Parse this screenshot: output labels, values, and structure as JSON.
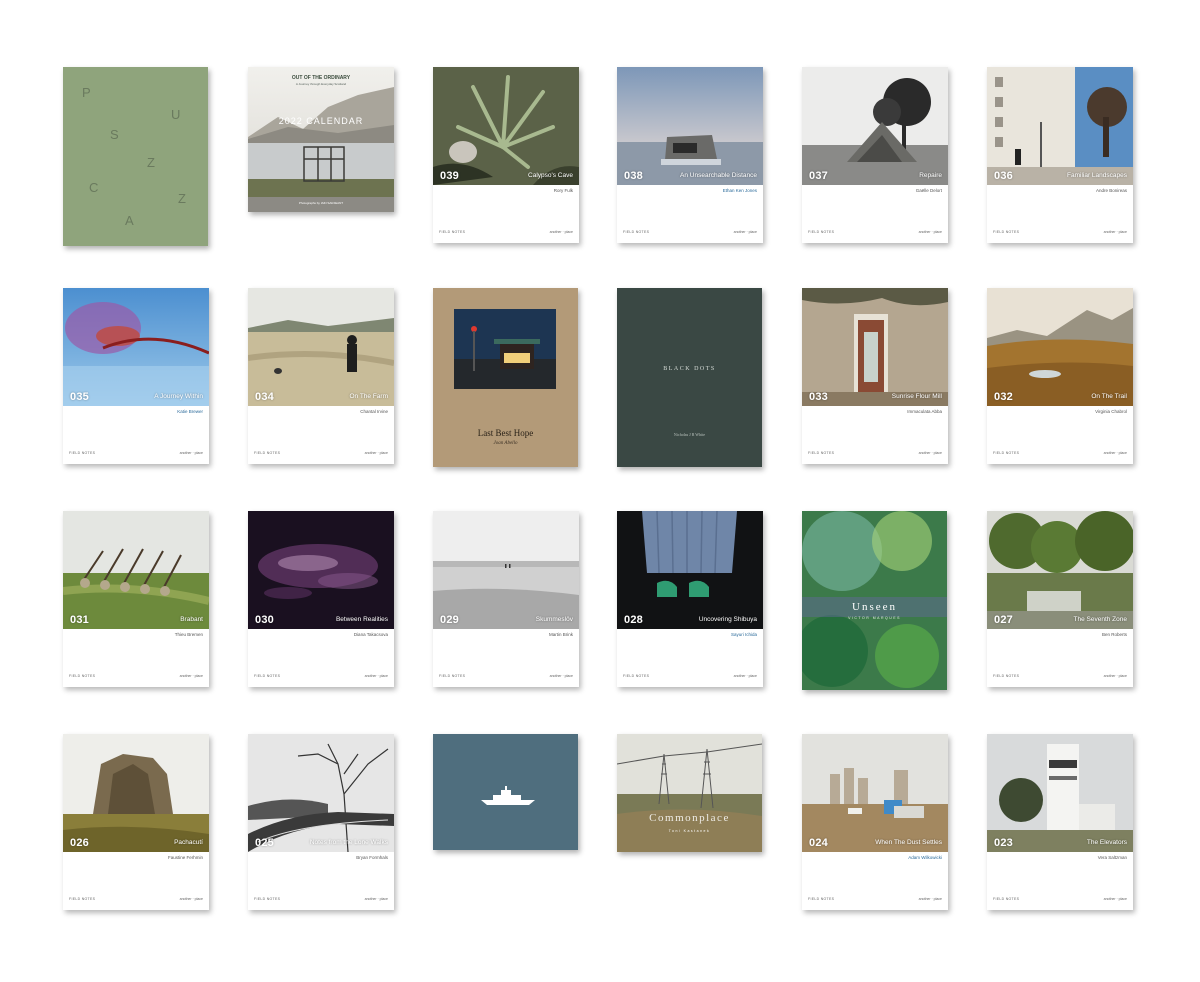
{
  "colors": {
    "background": "#ffffff",
    "fieldnotes_card": "#ffffff",
    "puszcza_cover": "#8fa47c",
    "last_best_hope_cover": "#b39a78",
    "black_dots_cover": "#3a4844",
    "ship_cover": "#4f6e7e"
  },
  "field_notes": {
    "series_label": "FIELD NOTES",
    "publisher_label": "another · place",
    "issues": [
      {
        "number": "039",
        "title": "Calypso's Cave",
        "author": "Rory Fulk"
      },
      {
        "number": "038",
        "title": "An Unsearchable Distance",
        "author": "Ethan Ken Jones"
      },
      {
        "number": "037",
        "title": "Repaire",
        "author": "Gaëlle Delort"
      },
      {
        "number": "036",
        "title": "Familiar Landscapes",
        "author": "Andre Bonireas"
      },
      {
        "number": "035",
        "title": "A Journey Within",
        "author": "Katie Brewer"
      },
      {
        "number": "034",
        "title": "On The Farm",
        "author": "Chantal Irvine"
      },
      {
        "number": "033",
        "title": "Sunrise Flour Mill",
        "author": "Immaculata Abba"
      },
      {
        "number": "032",
        "title": "On The Trail",
        "author": "Virginia Chabrol"
      },
      {
        "number": "031",
        "title": "Brabant",
        "author": "Thieu Bremen"
      },
      {
        "number": "030",
        "title": "Between Realities",
        "author": "Diana Takacsova"
      },
      {
        "number": "029",
        "title": "Skummeslöv",
        "author": "Martin Brink"
      },
      {
        "number": "028",
        "title": "Uncovering Shibuya",
        "author": "Sayuri Ichida"
      },
      {
        "number": "027",
        "title": "The Seventh Zone",
        "author": "Ben Roberts"
      },
      {
        "number": "026",
        "title": "Pachacutí",
        "author": "Faustine Ferhmin"
      },
      {
        "number": "025",
        "title": "Notes from the Lone Walks",
        "author": "Bryan Formhals"
      },
      {
        "number": "024",
        "title": "When The Dust Settles",
        "author": "Adam Wilkowicki"
      },
      {
        "number": "023",
        "title": "The Elevators",
        "author": "Vera Saltzman"
      }
    ]
  },
  "puszcza": {
    "letters": [
      "P",
      "U",
      "S",
      "Z",
      "C",
      "Z",
      "A",
      "Z"
    ]
  },
  "calendar": {
    "heading": "OUT OF THE ORDINARY",
    "subheading": "A Journey through Everyday Scotland",
    "title": "2022 CALENDAR",
    "credit": "Photographs by IAIN SARJEANT"
  },
  "last_best_hope": {
    "title": "Last Best Hope",
    "author": "Joan Abello"
  },
  "black_dots": {
    "title": "BLACK DOTS",
    "author": "Nicholas J R White"
  },
  "unseen": {
    "title": "Unseen",
    "subtitle": "VICTOR MARQUES"
  },
  "commonplace": {
    "title": "Commonplace",
    "author": "Toni Kastanek"
  }
}
